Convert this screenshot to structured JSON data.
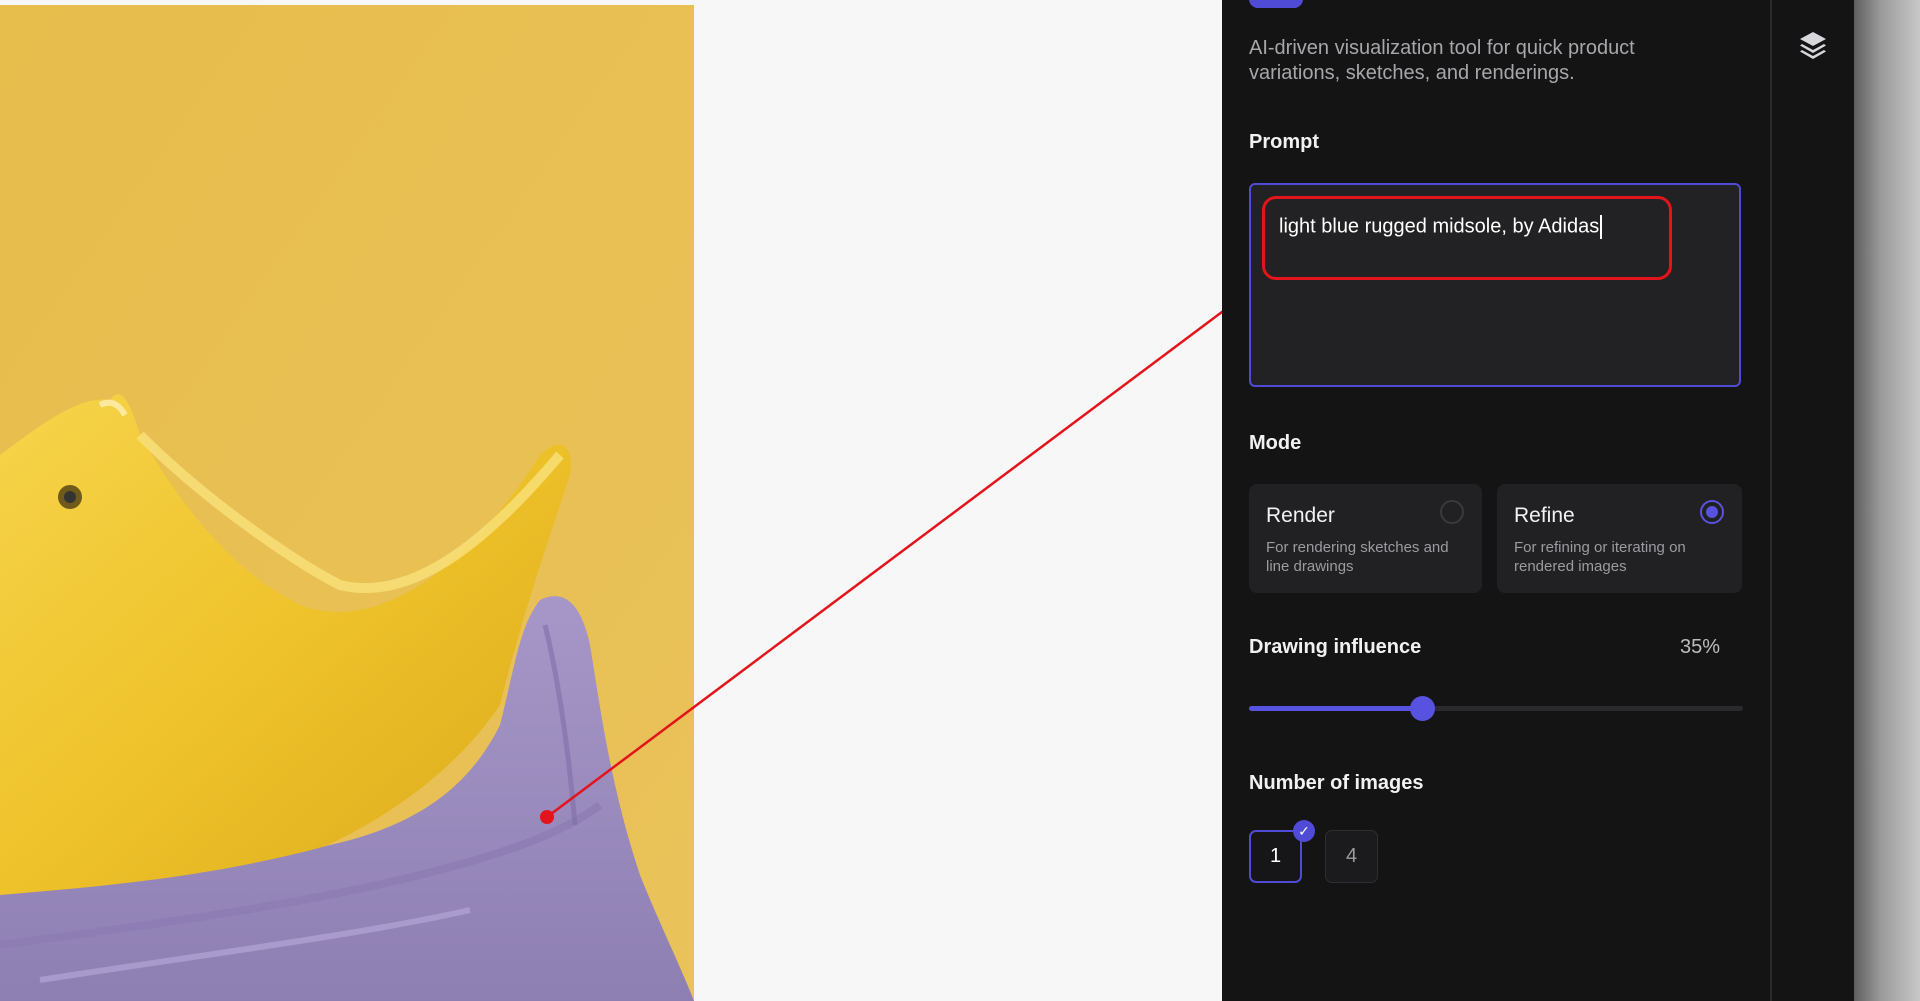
{
  "panel": {
    "description": "AI-driven visualization tool for quick product variations, sketches, and renderings.",
    "prompt": {
      "label": "Prompt",
      "value": "light blue rugged midsole, by Adidas"
    },
    "mode": {
      "label": "Mode",
      "options": [
        {
          "title": "Render",
          "description": "For rendering sketches and line drawings",
          "selected": false
        },
        {
          "title": "Refine",
          "description": "For refining or iterating on rendered images",
          "selected": true
        }
      ]
    },
    "drawing_influence": {
      "label": "Drawing influence",
      "value_text": "35%",
      "value": 0.35
    },
    "number_of_images": {
      "label": "Number of images",
      "options": [
        "1",
        "4"
      ],
      "selected": "1",
      "check_glyph": "✓"
    }
  },
  "side_rail": {
    "icon": "layers-icon"
  },
  "colors": {
    "accent": "#5753e0",
    "annotation": "#e3141b",
    "panel_bg": "#141414",
    "image_yellow": "#e4bd4e",
    "image_purple": "#9d8cbd"
  }
}
